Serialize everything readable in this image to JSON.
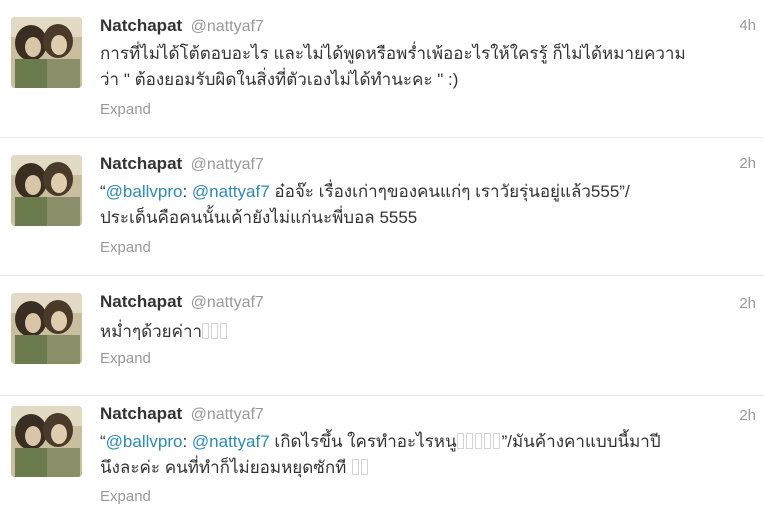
{
  "tweets": [
    {
      "fullname": "Natchapat",
      "username": "@nattyaf7",
      "time": "4h",
      "line1": "การที่ไม่ได้โต้ตอบอะไร และไม่ได้พูดหรือพร่ำเพ้ออะไรให้ใครรู้ ก็ไม่ได้หมายความ",
      "line2": "ว่า \" ต้องยอมรับผิดในสิ่งที่ตัวเองไม่ได้ทำนะคะ \" :)",
      "expand": "Expand"
    },
    {
      "fullname": "Natchapat",
      "username": "@nattyaf7",
      "time": "2h",
      "quote_open": "“",
      "mention1": "@ballvpro",
      "sep": ": ",
      "mention2": "@nattyaf7",
      "rest1": " อ๋อจ๊ะ เรื่องเก่าๆของคนแก่ๆ เราวัยรุ่นอยู่แล้ว555”/",
      "line2": "ประเด็นคือคนนั้นเค้ายังไม่แก่นะพี่บอล 5555",
      "expand": "Expand"
    },
    {
      "fullname": "Natchapat",
      "username": "@nattyaf7",
      "time": "2h",
      "line1": "หม่ำๆด้วยค่าา",
      "expand": "Expand"
    },
    {
      "fullname": "Natchapat",
      "username": "@nattyaf7",
      "time": "2h",
      "quote_open": "“",
      "mention1": "@ballvpro",
      "sep": ": ",
      "mention2": "@nattyaf7",
      "rest1": " เกิดไรขึ้น ใครทำอะไรหนู",
      "rest1b": "”/มันค้างคาแบบนี้มาปี",
      "line2": "นึงละค่ะ คนที่ทำก็ไม่ยอมหยุดซักที",
      "expand": "Expand"
    }
  ],
  "colors": {
    "mention": "#2f89b3",
    "meta": "#999999",
    "text": "#333333"
  }
}
